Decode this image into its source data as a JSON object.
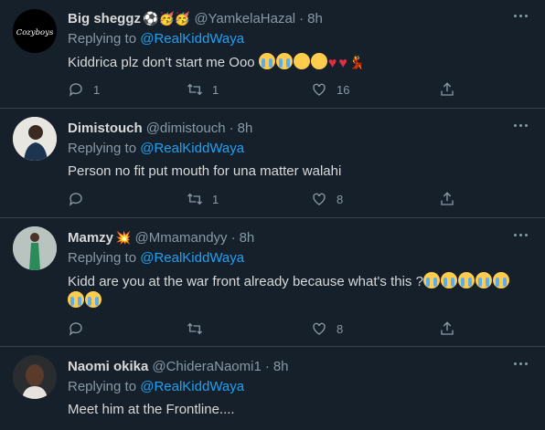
{
  "tweets": [
    {
      "name": "Big sheggz",
      "name_emoji": "⚽🥳🥳",
      "handle": "@YamkelaHazal",
      "time": "8h",
      "replying_prefix": "Replying to ",
      "replying_to": "@RealKiddWaya",
      "text": "Kiddrica plz don't start me Ooo",
      "actions": {
        "reply": "1",
        "retweet": "1",
        "like": "16"
      }
    },
    {
      "name": "Dimistouch",
      "name_emoji": "",
      "handle": "@dimistouch",
      "time": "8h",
      "replying_prefix": "Replying to ",
      "replying_to": "@RealKiddWaya",
      "text": "Person no fit put mouth for una matter walahi",
      "actions": {
        "reply": "",
        "retweet": "1",
        "like": "8"
      }
    },
    {
      "name": "Mamzy",
      "name_emoji": "💥",
      "handle": "@Mmamandyy",
      "time": "8h",
      "replying_prefix": "Replying to ",
      "replying_to": "@RealKiddWaya",
      "text": "Kidd are you at the war front already because what's this ?",
      "actions": {
        "reply": "",
        "retweet": "",
        "like": "8"
      }
    },
    {
      "name": "Naomi okika",
      "name_emoji": "",
      "handle": "@ChideraNaomi1",
      "time": "8h",
      "replying_prefix": "Replying to ",
      "replying_to": "@RealKiddWaya",
      "text": "Meet him at the Frontline....",
      "actions": {
        "reply": "",
        "retweet": "",
        "like": ""
      }
    }
  ],
  "avatars": {
    "t0": "Cozyboys"
  },
  "colors": {
    "background": "#15202b",
    "divider": "#38444d",
    "muted": "#8899a6",
    "link": "#1da1f2",
    "text": "#d9d9d9"
  },
  "icons": [
    "reply-icon",
    "retweet-icon",
    "like-icon",
    "share-icon",
    "more-icon"
  ]
}
